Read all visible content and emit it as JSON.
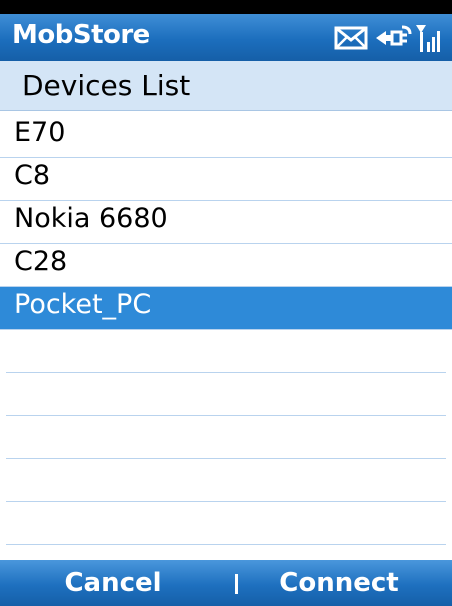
{
  "app": {
    "title": "MobStore"
  },
  "status_icons": [
    "envelope-icon",
    "connection-icon",
    "signal-icon"
  ],
  "header": {
    "label": "Devices List"
  },
  "devices": [
    {
      "label": "E70",
      "selected": false
    },
    {
      "label": "C8",
      "selected": false
    },
    {
      "label": "Nokia 6680",
      "selected": false
    },
    {
      "label": "C28",
      "selected": false
    },
    {
      "label": "Pocket_PC",
      "selected": true
    }
  ],
  "softkeys": {
    "left": "Cancel",
    "right": "Connect"
  },
  "colors": {
    "title_bar": "#1c6ebd",
    "header_bg": "#d4e5f6",
    "selection": "#2e8ad8",
    "row_divider": "#b9d3ee"
  }
}
